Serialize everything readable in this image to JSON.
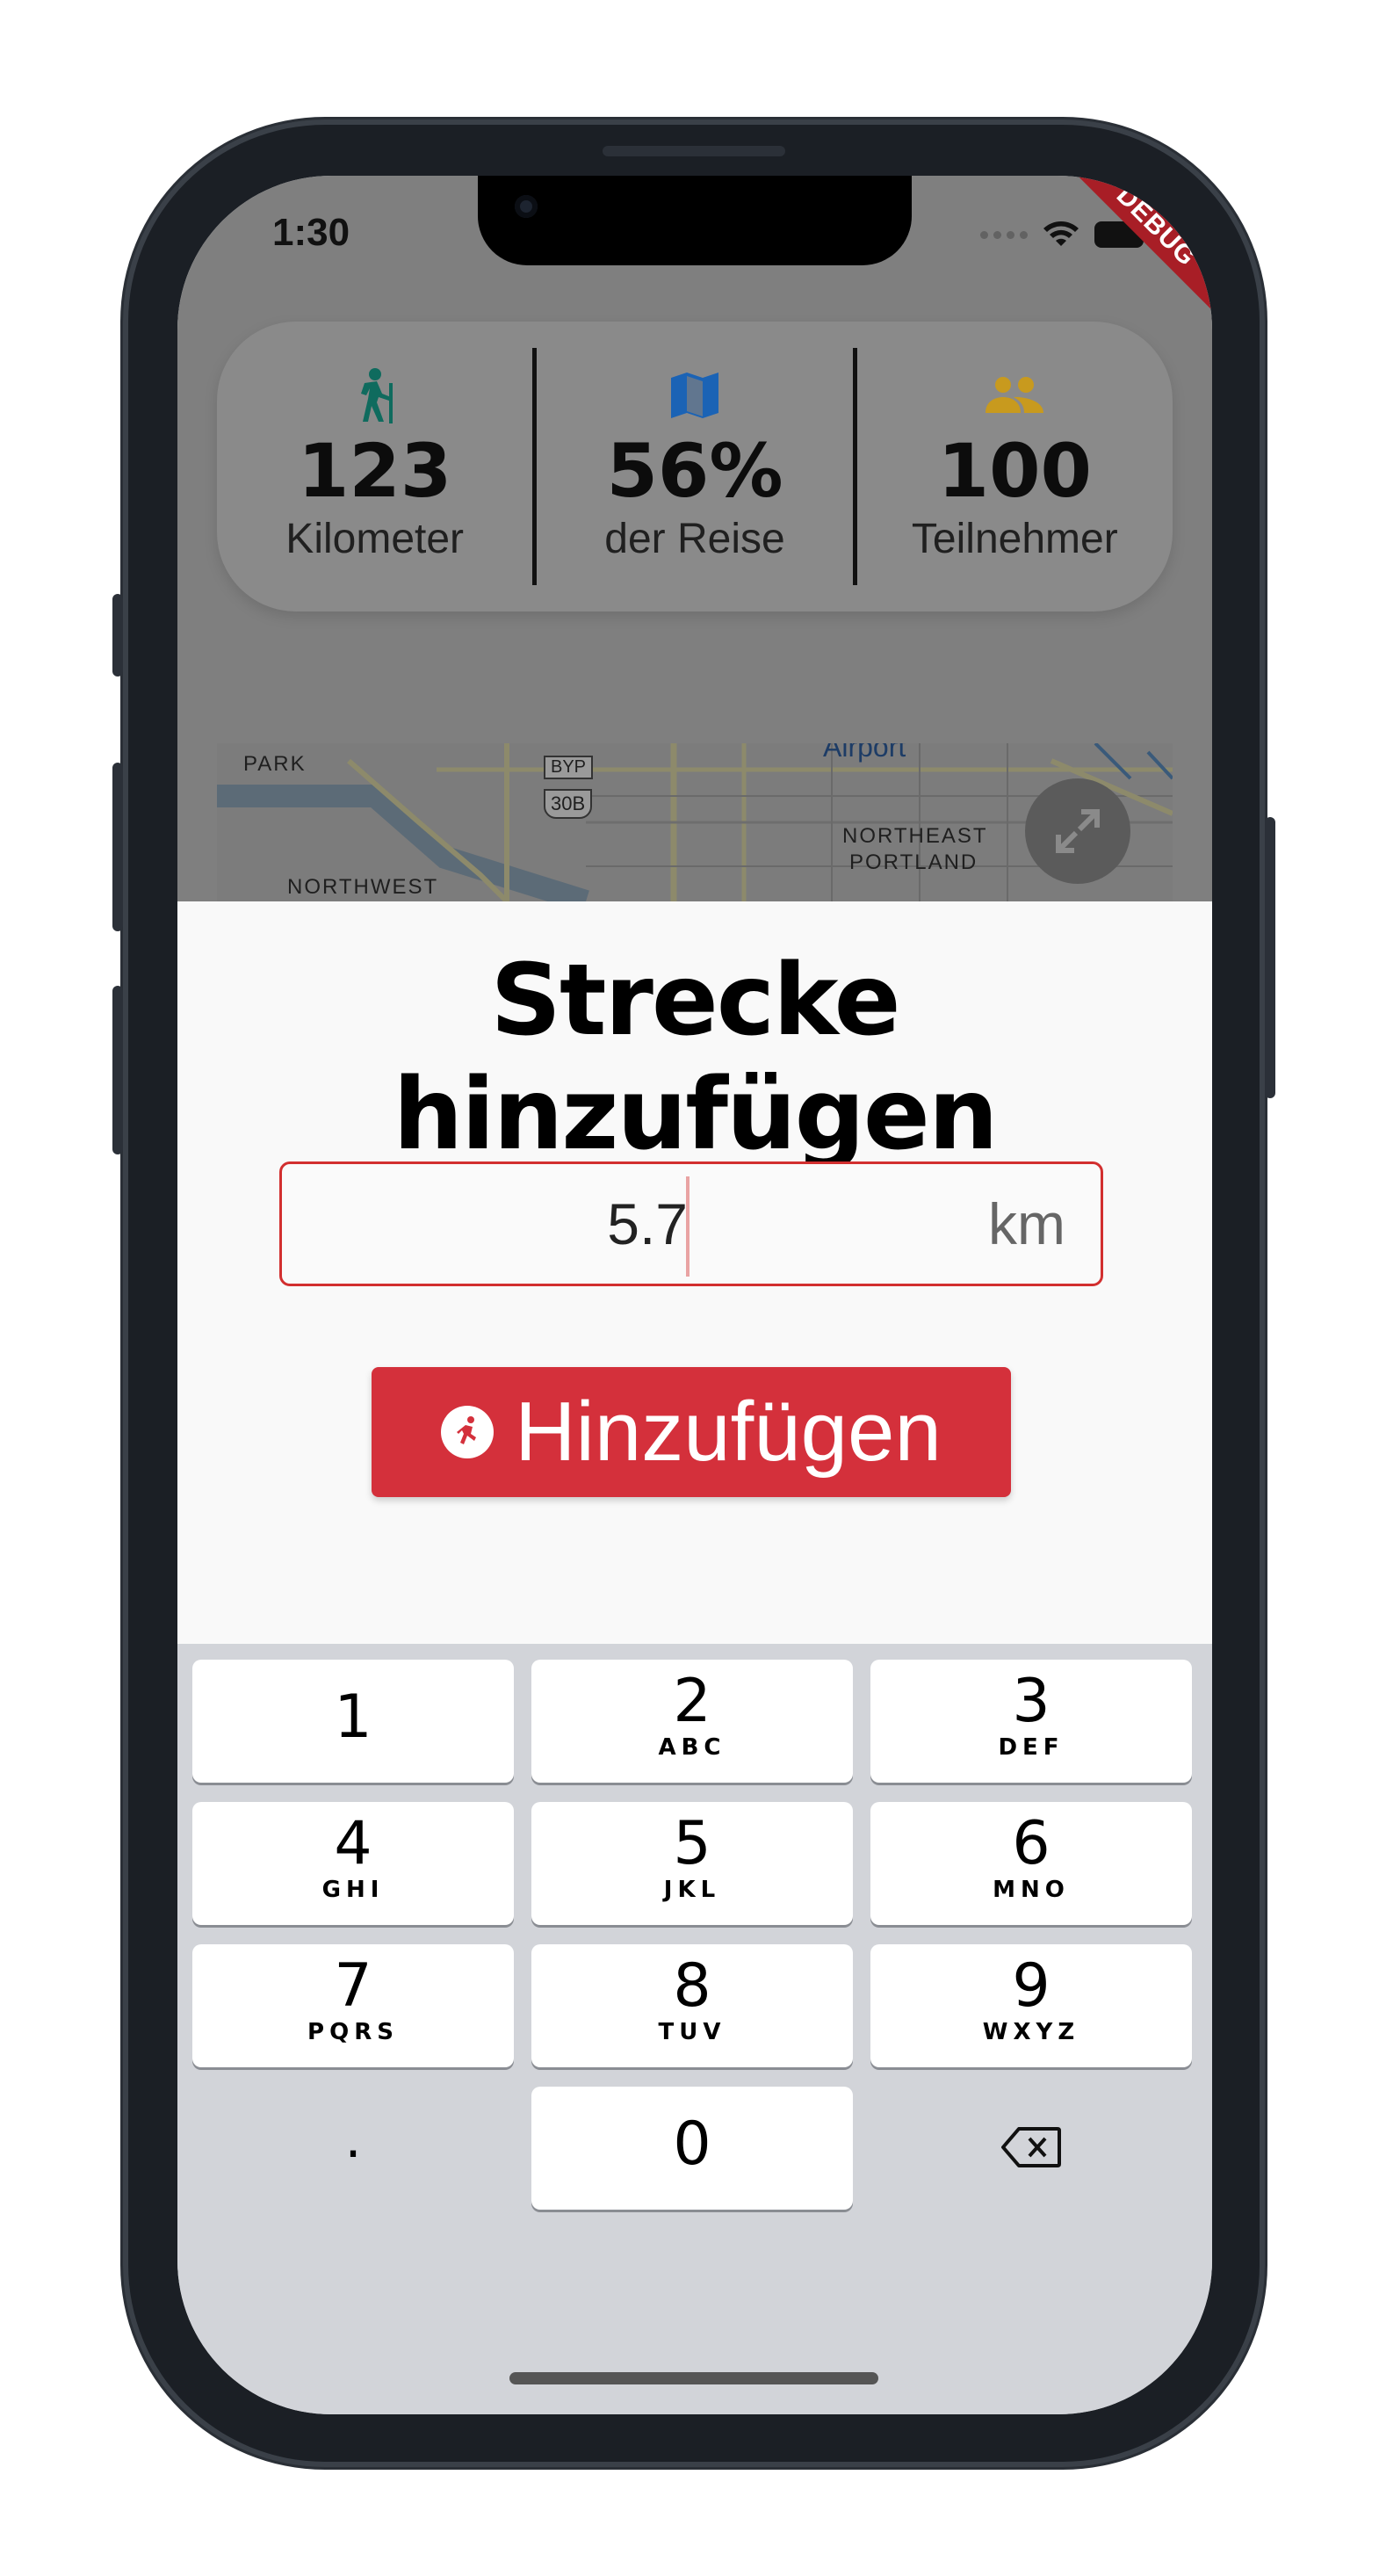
{
  "status_bar": {
    "time": "1:30",
    "debug_banner": "DEBUG"
  },
  "stats": [
    {
      "icon": "hiking-icon",
      "icon_color": "#0f6b5e",
      "value": "123",
      "label": "Kilometer"
    },
    {
      "icon": "map-icon",
      "icon_color": "#1b63b5",
      "value": "56%",
      "label": "der Reise"
    },
    {
      "icon": "people-icon",
      "icon_color": "#c89a1e",
      "value": "100",
      "label": "Teilnehmer"
    }
  ],
  "map": {
    "labels": {
      "park": "PARK",
      "byp": "BYP",
      "route": "30B",
      "airport": "Airport",
      "northeast": "NORTHEAST",
      "portland": "PORTLAND",
      "northwest": "NORTHWEST"
    },
    "expand_icon": "expand-icon"
  },
  "sheet": {
    "title": "Strecke hinzufügen",
    "km_input": {
      "value": "5.7",
      "unit": "km"
    },
    "add_button": {
      "label": "Hinzufügen",
      "icon": "running-icon"
    }
  },
  "keyboard": {
    "keys": [
      {
        "digit": "1",
        "letters": ""
      },
      {
        "digit": "2",
        "letters": "ABC"
      },
      {
        "digit": "3",
        "letters": "DEF"
      },
      {
        "digit": "4",
        "letters": "GHI"
      },
      {
        "digit": "5",
        "letters": "JKL"
      },
      {
        "digit": "6",
        "letters": "MNO"
      },
      {
        "digit": "7",
        "letters": "PQRS"
      },
      {
        "digit": "8",
        "letters": "TUV"
      },
      {
        "digit": "9",
        "letters": "WXYZ"
      }
    ],
    "decimal": ".",
    "zero": "0",
    "delete_icon": "backspace-icon"
  },
  "colors": {
    "accent": "#d4303b",
    "field_border": "#d22f2f"
  }
}
